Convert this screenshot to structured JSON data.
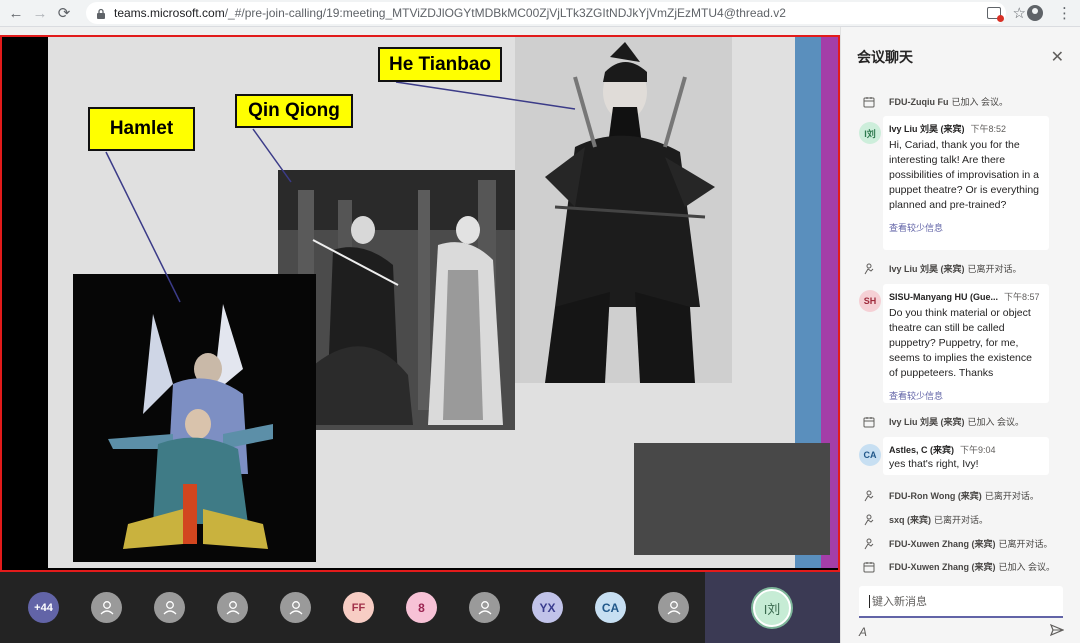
{
  "browser": {
    "url_host": "teams.microsoft.com",
    "url_path": "/_#/pre-join-calling/19:meeting_MTViZDJlOGYtMDBkMC00ZjVjLTk3ZGItNDJkYjVmZjEzMTU4@thread.v2"
  },
  "slide": {
    "labels": {
      "hamlet": "Hamlet",
      "qin_qiong": "Qin Qiong",
      "he_tianbao": "He Tianbao"
    }
  },
  "callbar": {
    "participants": [
      {
        "type": "count",
        "label": "+44"
      },
      {
        "type": "gray",
        "label": ""
      },
      {
        "type": "gray",
        "label": ""
      },
      {
        "type": "gray",
        "label": ""
      },
      {
        "type": "gray",
        "label": ""
      },
      {
        "type": "initials",
        "label": "FF"
      },
      {
        "type": "initials",
        "label": "8"
      },
      {
        "type": "gray",
        "label": ""
      },
      {
        "type": "initials",
        "label": "YX"
      },
      {
        "type": "initials",
        "label": "CA"
      },
      {
        "type": "gray",
        "label": ""
      }
    ],
    "spotlight_initials": "I刘"
  },
  "chat": {
    "title": "会议聊天",
    "compose_placeholder": "键入新消息",
    "events": [
      {
        "name": "FDU-Zuqiu Fu",
        "action": "已加入 会议。"
      },
      {
        "name": "Ivy Liu 刘昊 (来宾)",
        "action": "已离开对话。"
      },
      {
        "name": "Ivy Liu 刘昊 (来宾)",
        "action": "已加入 会议。"
      },
      {
        "name": "FDU-Ron Wong (来宾)",
        "action": "已离开对话。"
      },
      {
        "name": "sxq (来宾)",
        "action": "已离开对话。"
      },
      {
        "name": "FDU-Xuwen Zhang (来宾)",
        "action": "已离开对话。"
      },
      {
        "name": "FDU-Xuwen Zhang (来宾)",
        "action": "已加入 会议。"
      }
    ],
    "messages": [
      {
        "initials": "I刘",
        "author": "Ivy Liu 刘昊 (来宾)",
        "time": "下午8:52",
        "text": "Hi, Cariad, thank you for the interesting talk! Are there possibilities of improvisation in a puppet theatre? Or is everything planned and pre-trained?",
        "more": "查看较少信息"
      },
      {
        "initials": "SH",
        "author": "SISU-Manyang HU (Gue...",
        "time": "下午8:57",
        "text": "Do you think material or object theatre can still be called puppetry? Puppetry, for me, seems to implies the existence of puppeteers. Thanks",
        "more": "查看较少信息"
      },
      {
        "initials": "CA",
        "author": "Astles, C (来宾)",
        "time": "下午9:04",
        "text": "yes that's right, Ivy!",
        "more": ""
      }
    ]
  },
  "colors": {
    "accent": "#6264a7",
    "stage_border": "#e21b1b",
    "label_yellow": "#ffff00"
  }
}
